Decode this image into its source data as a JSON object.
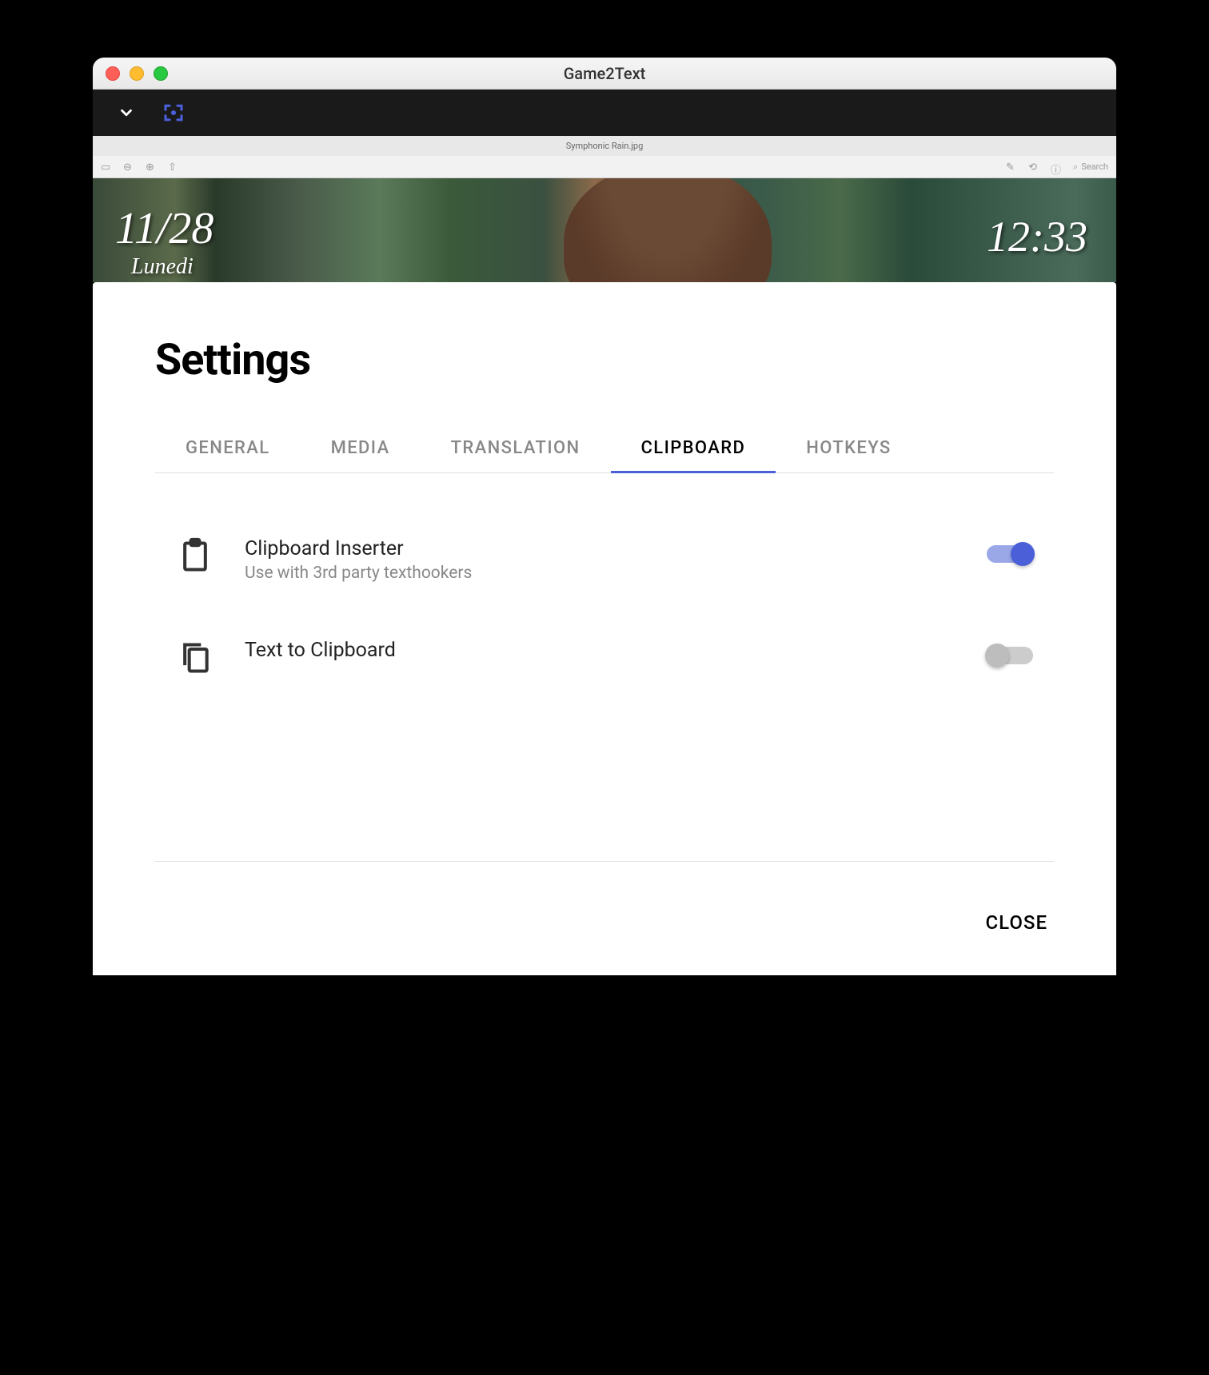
{
  "window": {
    "title": "Game2Text"
  },
  "preview": {
    "filename": "Symphonic Rain.jpg",
    "search_placeholder": "Search"
  },
  "game_overlay": {
    "date": "11/28",
    "day": "Lunedi",
    "time": "12:33"
  },
  "modal": {
    "title": "Settings",
    "tabs": {
      "general": "GENERAL",
      "media": "MEDIA",
      "translation": "TRANSLATION",
      "clipboard": "CLIPBOARD",
      "hotkeys": "HOTKEYS"
    },
    "settings": {
      "clipboard_inserter": {
        "label": "Clipboard Inserter",
        "sub": "Use with 3rd party texthookers"
      },
      "text_to_clipboard": {
        "label": "Text to Clipboard"
      }
    },
    "close": "CLOSE"
  }
}
